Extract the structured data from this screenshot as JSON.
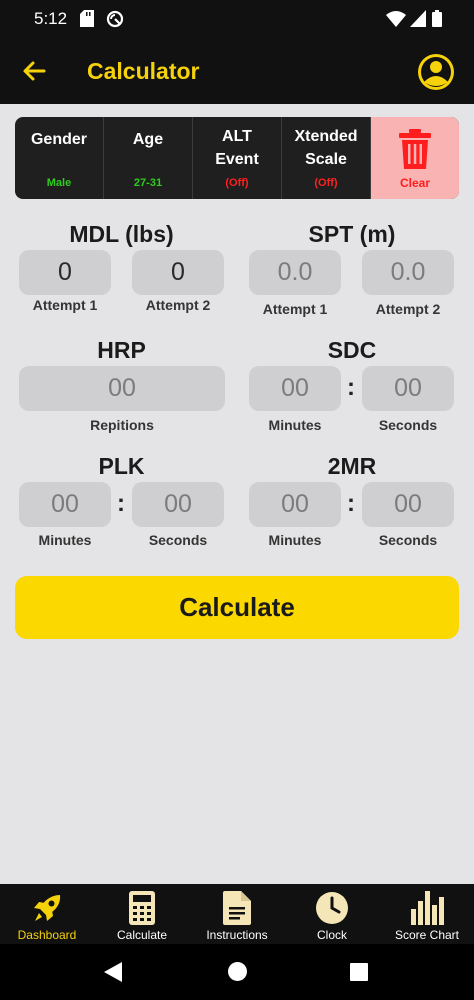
{
  "status_bar": {
    "time": "5:12"
  },
  "app_bar": {
    "title": "Calculator"
  },
  "settings": {
    "items": [
      {
        "label": "Gender",
        "value": "Male"
      },
      {
        "label": "Age",
        "value": "27-31"
      },
      {
        "label": "ALT Event",
        "value": "(Off)"
      },
      {
        "label": "Xtended Scale",
        "value": "(Off)"
      }
    ],
    "clear_label": "Clear"
  },
  "events": {
    "mdl": {
      "title": "MDL (lbs)",
      "attempt1_value": "0",
      "attempt2_value": "0",
      "attempt1_label": "Attempt 1",
      "attempt2_label": "Attempt 2"
    },
    "spt": {
      "title": "SPT (m)",
      "attempt1_placeholder": "0.0",
      "attempt2_placeholder": "0.0",
      "attempt1_label": "Attempt 1",
      "attempt2_label": "Attempt 2"
    },
    "hrp": {
      "title": "HRP",
      "placeholder": "00",
      "label": "Repitions"
    },
    "sdc": {
      "title": "SDC",
      "min_placeholder": "00",
      "sec_placeholder": "00",
      "min_label": "Minutes",
      "sec_label": "Seconds"
    },
    "plk": {
      "title": "PLK",
      "min_placeholder": "00",
      "sec_placeholder": "00",
      "min_label": "Minutes",
      "sec_label": "Seconds"
    },
    "tmr": {
      "title": "2MR",
      "min_placeholder": "00",
      "sec_placeholder": "00",
      "min_label": "Minutes",
      "sec_label": "Seconds"
    },
    "colon": ":"
  },
  "calculate_button": "Calculate",
  "bottom_nav": {
    "items": [
      {
        "label": "Dashboard",
        "icon": "rocket-icon",
        "active": true
      },
      {
        "label": "Calculate",
        "icon": "calculator-icon",
        "active": false
      },
      {
        "label": "Instructions",
        "icon": "document-icon",
        "active": false
      },
      {
        "label": "Clock",
        "icon": "clock-icon",
        "active": false
      },
      {
        "label": "Score Chart",
        "icon": "bar-chart-icon",
        "active": false
      }
    ]
  },
  "colors": {
    "accent": "#f5d20a",
    "bar": "#111111",
    "background": "#e4e3e5",
    "danger": "#ff1d1d"
  }
}
